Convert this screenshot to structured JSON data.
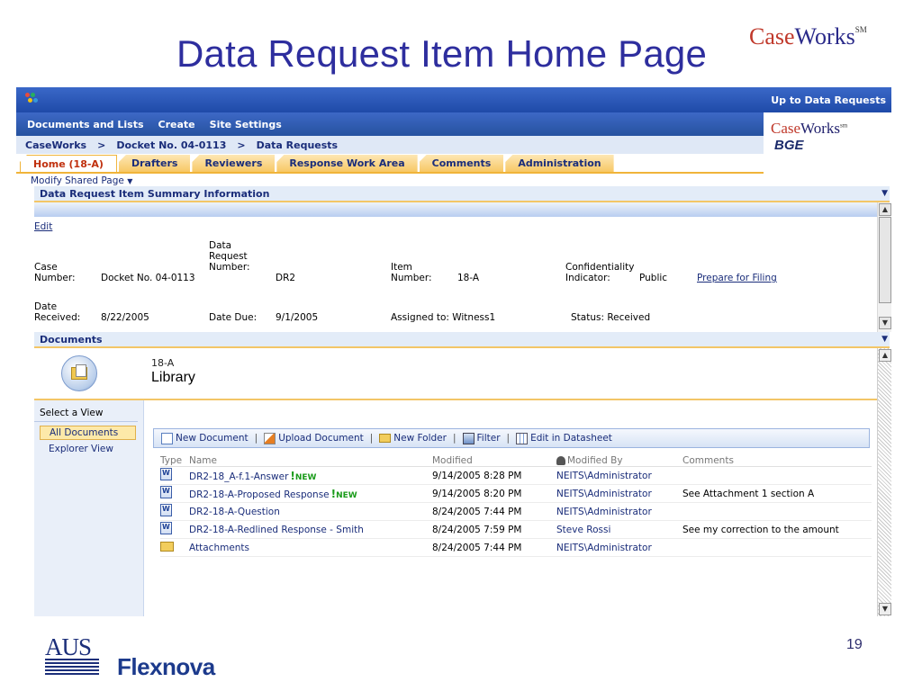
{
  "slide": {
    "title": "Data Request Item Home Page",
    "logo_case": "Case",
    "logo_works": "Works",
    "logo_sm": "SM",
    "page_number": "19",
    "footer_logo_aus": "AUS",
    "footer_logo_flexnova": "Flexnova"
  },
  "topbar": {
    "up_link": "Up to Data Requests"
  },
  "menu": [
    "Documents and Lists",
    "Create",
    "Site Settings"
  ],
  "breadcrumb": [
    "CaseWorks",
    "Docket No. 04-0113",
    "Data Requests"
  ],
  "site_logo": {
    "case": "Case",
    "works": "Works",
    "sm": "sm",
    "bge": "BGE"
  },
  "tabs": [
    "Home (18-A)",
    "Drafters",
    "Reviewers",
    "Response Work Area",
    "Comments",
    "Administration"
  ],
  "modify_shared_page": "Modify Shared Page",
  "summary_section": {
    "title": "Data Request Item Summary Information",
    "edit": "Edit",
    "case_number_label": "Case\nNumber:",
    "case_number_value": "Docket No. 04-0113",
    "dr_number_label": "Data\nRequest\nNumber:",
    "dr_number_value": "DR2",
    "item_number_label": "Item\nNumber:",
    "item_number_value": "18-A",
    "confidentiality_label": "Confidentiality\nIndicator:",
    "confidentiality_value": "Public",
    "prepare_link": "Prepare for Filing",
    "date_received_label": "Date\nReceived:",
    "date_received_value": "8/22/2005",
    "date_due_label": "Date Due:",
    "date_due_value": "9/1/2005",
    "assigned_to": "Assigned to: Witness1",
    "status": "Status: Received"
  },
  "documents_section": {
    "title": "Documents",
    "library_subtitle": "18-A",
    "library_title": "Library",
    "views_header": "Select a View",
    "views": [
      "All Documents",
      "Explorer View"
    ],
    "toolbar": [
      "New Document",
      "Upload Document",
      "New Folder",
      "Filter",
      "Edit in Datasheet"
    ],
    "columns": [
      "Type",
      "Name",
      "Modified",
      "Modified By",
      "Comments"
    ],
    "rows": [
      {
        "type": "word",
        "name": "DR2-18_A-f.1-Answer",
        "new": true,
        "modified": "9/14/2005 8:28 PM",
        "by": "NEITS\\Administrator",
        "comments": ""
      },
      {
        "type": "word",
        "name": "DR2-18-A-Proposed Response",
        "new": true,
        "modified": "9/14/2005 8:20 PM",
        "by": "NEITS\\Administrator",
        "comments": "See Attachment 1 section A"
      },
      {
        "type": "word",
        "name": "DR2-18-A-Question",
        "new": false,
        "modified": "8/24/2005 7:44 PM",
        "by": "NEITS\\Administrator",
        "comments": ""
      },
      {
        "type": "word",
        "name": "DR2-18-A-Redlined Response - Smith",
        "new": false,
        "modified": "8/24/2005 7:59 PM",
        "by": "Steve Rossi",
        "comments": "See my correction to the amount"
      },
      {
        "type": "folder",
        "name": "Attachments",
        "new": false,
        "modified": "8/24/2005 7:44 PM",
        "by": "NEITS\\Administrator",
        "comments": ""
      }
    ],
    "new_badge": "NEW"
  }
}
